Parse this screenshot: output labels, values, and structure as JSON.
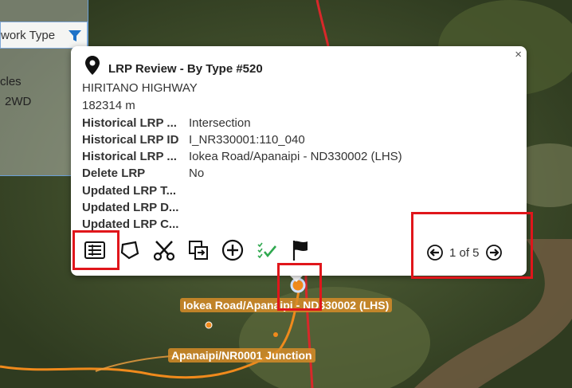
{
  "filter_panel": {
    "header_label": "work Type",
    "side_text_1": "cles",
    "side_text_2": "2WD"
  },
  "popup": {
    "title": "LRP Review - By Type #520",
    "road_name": "HIRITANO HIGHWAY",
    "distance": "182314 m",
    "rows": [
      {
        "key": "Historical LRP ...",
        "value": "Intersection"
      },
      {
        "key": "Historical LRP ID",
        "value": "I_NR330001:110_040"
      },
      {
        "key": "Historical LRP ...",
        "value": "Iokea Road/Apanaipi - ND330002 (LHS)"
      },
      {
        "key": "Delete LRP",
        "value": "No"
      },
      {
        "key": "Updated LRP T...",
        "value": ""
      },
      {
        "key": "Updated LRP D...",
        "value": ""
      },
      {
        "key": "Updated LRP C...",
        "value": ""
      }
    ],
    "close_glyph": "×",
    "pager_text": "1 of 5",
    "tools": [
      "table-view-icon",
      "polygon-edit-icon",
      "scissors-icon",
      "duplicate-icon",
      "add-circle-icon",
      "checklist-icon",
      "flag-icon"
    ]
  },
  "map_labels": {
    "label_1": "Iokea Road/Apanaipi - ND330002 (LHS)",
    "label_2": "Apanaipi/NR0001 Junction"
  },
  "colors": {
    "highlight_red": "#e0161b",
    "road_orange": "#f08a1c",
    "road_red": "#d8282a",
    "filter_blue": "#1e73c8",
    "check_green": "#2fa84f"
  }
}
